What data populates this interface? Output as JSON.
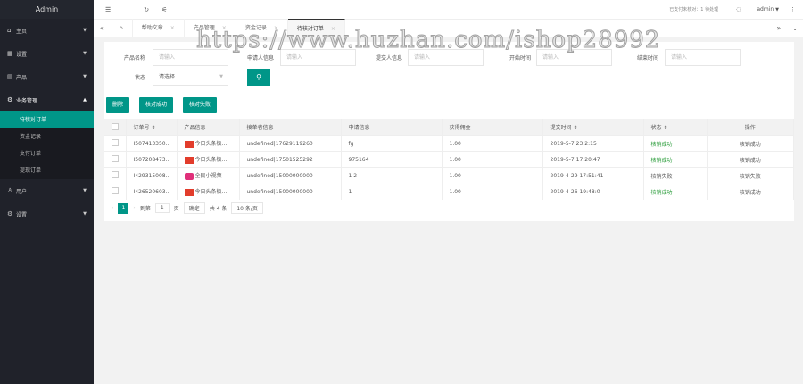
{
  "sidebar": {
    "title": "Admin",
    "items": [
      {
        "label": "主页"
      },
      {
        "label": "设置"
      },
      {
        "label": "产品"
      },
      {
        "label": "业务管理"
      },
      {
        "label": "用户"
      },
      {
        "label": "设置"
      }
    ],
    "subitems": [
      {
        "label": "待核对订单"
      },
      {
        "label": "资金记录"
      },
      {
        "label": "支付订单"
      },
      {
        "label": "提现订单"
      }
    ]
  },
  "header": {
    "notice": "已支付未核对：1 待处理",
    "user": "admin"
  },
  "tabs": [
    {
      "label": "帮助文章"
    },
    {
      "label": "产品管理"
    },
    {
      "label": "资金记录"
    },
    {
      "label": "待核对订单"
    }
  ],
  "filters": {
    "product_name": "产品名称",
    "applicant": "申请人信息",
    "submitter": "提交人信息",
    "start": "开始时间",
    "end": "结束时间",
    "status": "状态",
    "placeholder": "请输入",
    "status_value": "请选择"
  },
  "actions": {
    "delete": "删除",
    "check_ok": "核对成功",
    "check_fail": "核对失败"
  },
  "table": {
    "headers": [
      "订单号",
      "产品信息",
      "接单者信息",
      "申请信息",
      "获得佣金",
      "提交时间",
      "状态",
      "操作"
    ],
    "rows": [
      {
        "order": "I507413350...",
        "product": "今日头条极...",
        "taker": "undefined|17629119260",
        "apply": "fg",
        "commission": "1.00",
        "time": "2019-5-7 23:2:15",
        "status": "核销成功",
        "op": "核销成功",
        "ok": true,
        "icon": "r"
      },
      {
        "order": "I507208473...",
        "product": "今日头条极...",
        "taker": "undefined|17501525292",
        "apply": "975164",
        "commission": "1.00",
        "time": "2019-5-7 17:20:47",
        "status": "核销成功",
        "op": "核销成功",
        "ok": true,
        "icon": "r"
      },
      {
        "order": "I429315008...",
        "product": "全民小视频",
        "taker": "undefined|15000000000",
        "apply": "1 2",
        "commission": "1.00",
        "time": "2019-4-29 17:51:41",
        "status": "核销失败",
        "op": "核销失败",
        "ok": false,
        "icon": "p"
      },
      {
        "order": "I426520603...",
        "product": "今日头条极...",
        "taker": "undefined|15000000000",
        "apply": "1",
        "commission": "1.00",
        "time": "2019-4-26 19:48:0",
        "status": "核销成功",
        "op": "核销成功",
        "ok": true,
        "icon": "r"
      }
    ]
  },
  "pager": {
    "current": "1",
    "goto": "到第",
    "page": "1",
    "page_unit": "页",
    "confirm": "确定",
    "total": "共 4 条",
    "per_page": "10 条/页"
  },
  "watermark": "https://www.huzhan.com/ishop28992"
}
